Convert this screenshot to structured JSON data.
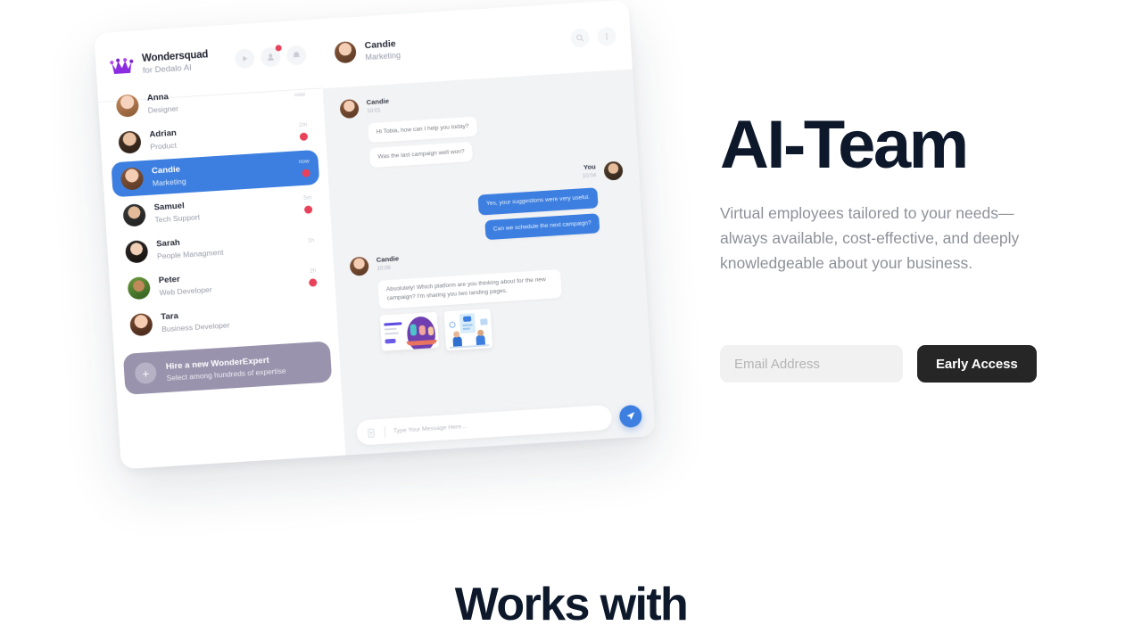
{
  "hero": {
    "title": "AI-Team",
    "subtitle": "Virtual employees tailored to your needs—always available, cost-effective, and deeply knowledgeable about your business.",
    "email_placeholder": "Email Address",
    "email_value": "",
    "cta_label": "Early Access"
  },
  "section": {
    "works_with": "Works with"
  },
  "colors": {
    "heading": "#0d182b",
    "body_text": "#8e9199",
    "cta_bg": "#262626",
    "input_bg": "#f1f1f1",
    "accent_blue": "#3d7fe0",
    "unread_red": "#e8425a",
    "hire_purple": "#9a93ad",
    "crown_purple": "#8a2be2"
  },
  "app_mock": {
    "sidebar": {
      "brand_name": "Wondersquad",
      "brand_sub": "for Dedalo AI",
      "logo_icon": "crown-icon",
      "header_actions": [
        {
          "icon": "play-icon",
          "badge": false
        },
        {
          "icon": "person-icon",
          "badge": true
        },
        {
          "icon": "bell-icon",
          "badge": false
        }
      ],
      "contacts": [
        {
          "name": "Anna",
          "role": "Designer",
          "time": "now",
          "unread": false,
          "active": false
        },
        {
          "name": "Adrian",
          "role": "Product",
          "time": "2m",
          "unread": true,
          "active": false
        },
        {
          "name": "Candie",
          "role": "Marketing",
          "time": "now",
          "unread": true,
          "active": true
        },
        {
          "name": "Samuel",
          "role": "Tech Support",
          "time": "5m",
          "unread": true,
          "active": false
        },
        {
          "name": "Sarah",
          "role": "People Managment",
          "time": "1h",
          "unread": false,
          "active": false
        },
        {
          "name": "Peter",
          "role": "Web Developer",
          "time": "2h",
          "unread": true,
          "active": false
        },
        {
          "name": "Tara",
          "role": "Business Developer",
          "time": "",
          "unread": false,
          "active": false
        }
      ],
      "hire_card": {
        "title": "Hire a new WonderExpert",
        "subtitle": "Select among hundreds of expertise",
        "icon": "plus-icon"
      }
    },
    "chat": {
      "header": {
        "name": "Candie",
        "role": "Marketing",
        "actions": [
          {
            "icon": "search-icon"
          },
          {
            "icon": "more-vertical-icon"
          }
        ]
      },
      "groups": [
        {
          "sender": "Candie",
          "time": "10:01",
          "side": "left",
          "messages": [
            "Hi Tobia, how can I help you today?",
            "Was the last campaign well won?"
          ]
        },
        {
          "sender": "You",
          "time": "10:04",
          "side": "right",
          "messages": [
            "Yes, your suggestions were very useful.",
            "Can we schedule the next campaign?"
          ]
        },
        {
          "sender": "Candie",
          "time": "10:06",
          "side": "left",
          "messages": [
            "Absolutely! Which platform are you thinking about for the new campaign? I'm sharing you two landing pages."
          ],
          "attachments": [
            {
              "label": "Team Work landing page mockup"
            },
            {
              "label": "Office illustration mockup"
            }
          ]
        }
      ],
      "composer": {
        "placeholder": "Type Your Message Here...",
        "attach_icon": "attachment-icon",
        "send_icon": "send-icon"
      }
    }
  }
}
